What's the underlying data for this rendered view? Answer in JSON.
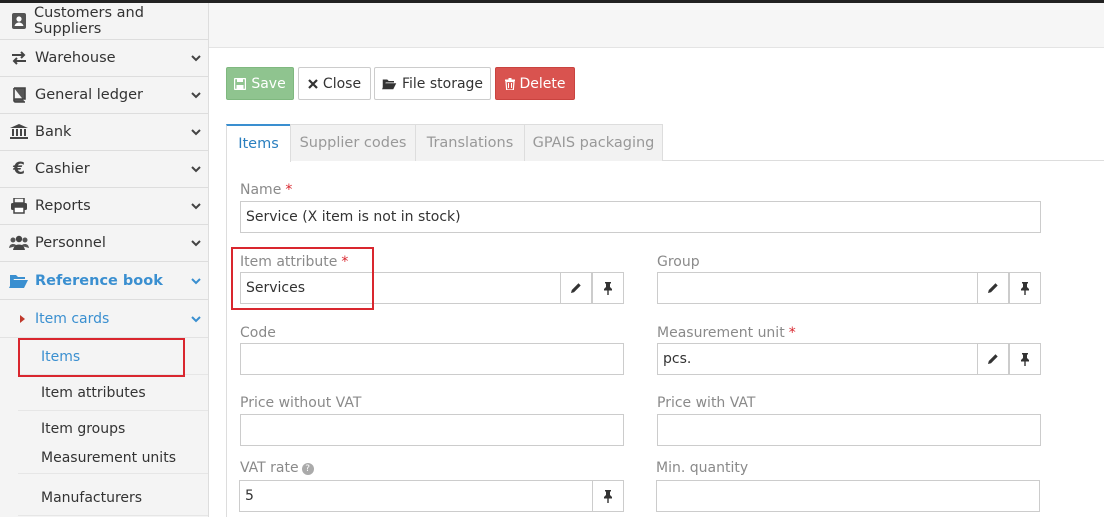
{
  "sidebar": {
    "items": [
      {
        "label": "Customers and Suppliers",
        "icon": "address-book-icon"
      },
      {
        "label": "Warehouse",
        "icon": "transfer-arrows-icon"
      },
      {
        "label": "General ledger",
        "icon": "book-icon"
      },
      {
        "label": "Bank",
        "icon": "bank-icon"
      },
      {
        "label": "Cashier",
        "icon": "euro-icon"
      },
      {
        "label": "Reports",
        "icon": "printer-icon"
      },
      {
        "label": "Personnel",
        "icon": "users-icon"
      },
      {
        "label": "Reference book",
        "icon": "folder-open-icon"
      }
    ],
    "sub": {
      "label": "Item cards"
    },
    "leaves": [
      "Items",
      "Item attributes",
      "Item groups",
      "Measurement units",
      "Manufacturers"
    ]
  },
  "toolbar": {
    "save": "Save",
    "close": "Close",
    "file_storage": "File storage",
    "delete": "Delete"
  },
  "tabs": [
    "Items",
    "Supplier codes",
    "Translations",
    "GPAIS packaging"
  ],
  "form": {
    "name_label": "Name",
    "name_value": "Service (X item is not in stock)",
    "item_attribute_label": "Item attribute",
    "item_attribute_value": "Services",
    "group_label": "Group",
    "group_value": "",
    "code_label": "Code",
    "code_value": "",
    "measurement_unit_label": "Measurement unit",
    "measurement_unit_value": "pcs.",
    "price_wo_vat_label": "Price without VAT",
    "price_wo_vat_value": "",
    "price_with_vat_label": "Price with VAT",
    "price_with_vat_value": "",
    "vat_rate_label": "VAT rate",
    "vat_rate_value": "5",
    "min_quantity_label": "Min. quantity",
    "min_quantity_value": ""
  },
  "colors": {
    "accent": "#3a8fd0",
    "save": "#8fc48f",
    "delete": "#d9534f",
    "highlight": "#d9262e"
  }
}
